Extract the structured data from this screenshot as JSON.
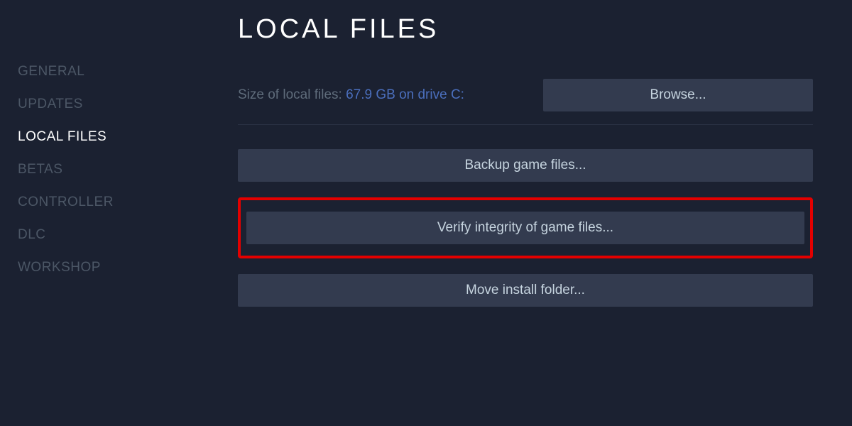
{
  "sidebar": {
    "items": [
      {
        "label": "GENERAL",
        "active": false
      },
      {
        "label": "UPDATES",
        "active": false
      },
      {
        "label": "LOCAL FILES",
        "active": true
      },
      {
        "label": "BETAS",
        "active": false
      },
      {
        "label": "CONTROLLER",
        "active": false
      },
      {
        "label": "DLC",
        "active": false
      },
      {
        "label": "WORKSHOP",
        "active": false
      }
    ]
  },
  "main": {
    "title": "LOCAL FILES",
    "size_label": "Size of local files: ",
    "size_value": "67.9 GB on drive C:",
    "browse_label": "Browse...",
    "backup_label": "Backup game files...",
    "verify_label": "Verify integrity of game files...",
    "move_label": "Move install folder..."
  }
}
